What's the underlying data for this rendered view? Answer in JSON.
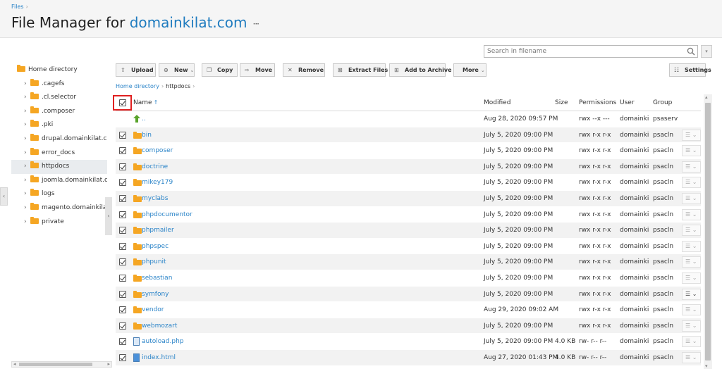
{
  "breadcrumb_top": {
    "label": "Files",
    "sep": "›"
  },
  "title": {
    "prefix": "File Manager for ",
    "domain": "domainkilat.com",
    "menu": "···"
  },
  "search": {
    "placeholder": "Search in filename"
  },
  "tree": {
    "root": "Home directory",
    "items": [
      {
        "label": ".cagefs",
        "active": false
      },
      {
        "label": ".cl.selector",
        "active": false
      },
      {
        "label": ".composer",
        "active": false
      },
      {
        "label": ".pki",
        "active": false
      },
      {
        "label": "drupal.domainkilat.com",
        "active": false
      },
      {
        "label": "error_docs",
        "active": false
      },
      {
        "label": "httpdocs",
        "active": true
      },
      {
        "label": "joomla.domainkilat.com",
        "active": false
      },
      {
        "label": "logs",
        "active": false
      },
      {
        "label": "magento.domainkilat.com",
        "active": false
      },
      {
        "label": "private",
        "active": false
      }
    ]
  },
  "toolbar": {
    "upload": "Upload",
    "new": "New",
    "copy": "Copy",
    "move": "Move",
    "remove": "Remove",
    "extract": "Extract Files",
    "archive": "Add to Archive",
    "more": "More",
    "settings": "Settings"
  },
  "path": {
    "home": "Home directory",
    "sep": "›",
    "current": "httpdocs"
  },
  "columns": {
    "name": "Name",
    "sort": "↑",
    "modified": "Modified",
    "size": "Size",
    "permissions": "Permissions",
    "user": "User",
    "group": "Group"
  },
  "rows": [
    {
      "name": "..",
      "type": "up",
      "modified": "Aug 28, 2020 09:57 PM",
      "size": "",
      "perms": "rwx --x ---",
      "user": "domainki",
      "group": "psaserv"
    },
    {
      "name": "bin",
      "type": "folder",
      "modified": "July 5, 2020 09:00 PM",
      "size": "",
      "perms": "rwx r-x r-x",
      "user": "domainki",
      "group": "psacln"
    },
    {
      "name": "composer",
      "type": "folder",
      "modified": "July 5, 2020 09:00 PM",
      "size": "",
      "perms": "rwx r-x r-x",
      "user": "domainki",
      "group": "psacln"
    },
    {
      "name": "doctrine",
      "type": "folder",
      "modified": "July 5, 2020 09:00 PM",
      "size": "",
      "perms": "rwx r-x r-x",
      "user": "domainki",
      "group": "psacln"
    },
    {
      "name": "mikey179",
      "type": "folder",
      "modified": "July 5, 2020 09:00 PM",
      "size": "",
      "perms": "rwx r-x r-x",
      "user": "domainki",
      "group": "psacln"
    },
    {
      "name": "myclabs",
      "type": "folder",
      "modified": "July 5, 2020 09:00 PM",
      "size": "",
      "perms": "rwx r-x r-x",
      "user": "domainki",
      "group": "psacln"
    },
    {
      "name": "phpdocumentor",
      "type": "folder",
      "modified": "July 5, 2020 09:00 PM",
      "size": "",
      "perms": "rwx r-x r-x",
      "user": "domainki",
      "group": "psacln"
    },
    {
      "name": "phpmailer",
      "type": "folder",
      "modified": "July 5, 2020 09:00 PM",
      "size": "",
      "perms": "rwx r-x r-x",
      "user": "domainki",
      "group": "psacln"
    },
    {
      "name": "phpspec",
      "type": "folder",
      "modified": "July 5, 2020 09:00 PM",
      "size": "",
      "perms": "rwx r-x r-x",
      "user": "domainki",
      "group": "psacln"
    },
    {
      "name": "phpunit",
      "type": "folder",
      "modified": "July 5, 2020 09:00 PM",
      "size": "",
      "perms": "rwx r-x r-x",
      "user": "domainki",
      "group": "psacln"
    },
    {
      "name": "sebastian",
      "type": "folder",
      "modified": "July 5, 2020 09:00 PM",
      "size": "",
      "perms": "rwx r-x r-x",
      "user": "domainki",
      "group": "psacln"
    },
    {
      "name": "symfony",
      "type": "folder",
      "modified": "July 5, 2020 09:00 PM",
      "size": "",
      "perms": "rwx r-x r-x",
      "user": "domainki",
      "group": "psacln"
    },
    {
      "name": "vendor",
      "type": "folder",
      "modified": "Aug 29, 2020 09:02 AM",
      "size": "",
      "perms": "rwx r-x r-x",
      "user": "domainki",
      "group": "psacln"
    },
    {
      "name": "webmozart",
      "type": "folder",
      "modified": "July 5, 2020 09:00 PM",
      "size": "",
      "perms": "rwx r-x r-x",
      "user": "domainki",
      "group": "psacln"
    },
    {
      "name": "autoload.php",
      "type": "php",
      "modified": "July 5, 2020 09:00 PM",
      "size": "4.0 KB",
      "perms": "rw- r-- r--",
      "user": "domainki",
      "group": "psacln"
    },
    {
      "name": "index.html",
      "type": "html",
      "modified": "Aug 27, 2020 01:43 PM",
      "size": "4.0 KB",
      "perms": "rw- r-- r--",
      "user": "domainki",
      "group": "psacln"
    }
  ],
  "icons": {
    "search": "search-icon",
    "folder": "folder-icon",
    "row_menu": "hamburger-menu-icon"
  },
  "colors": {
    "accent": "#2b84c8",
    "folder": "#f5a623",
    "highlight": "#e02020"
  }
}
